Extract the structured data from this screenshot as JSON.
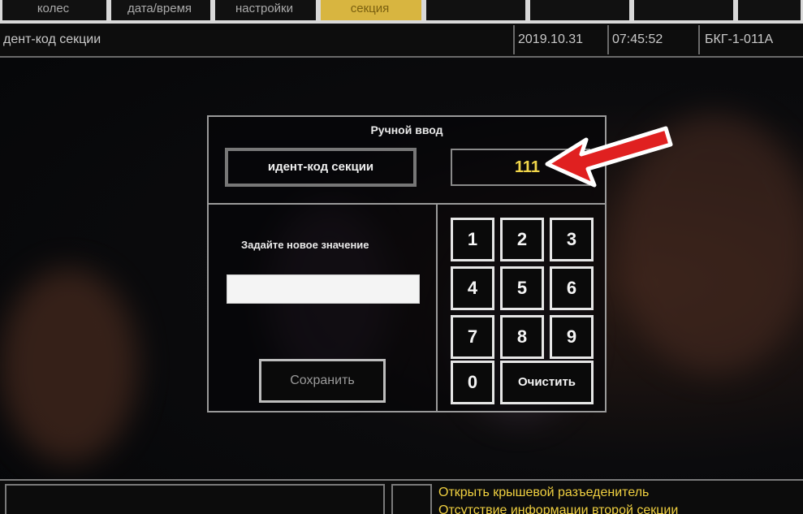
{
  "tabs": [
    {
      "label": "колес"
    },
    {
      "label": "дата/время"
    },
    {
      "label": "настройки"
    },
    {
      "label": "секция"
    }
  ],
  "status_bar": {
    "title": "дент-код секции",
    "date": "2019.10.31",
    "time": "07:45:52",
    "unit": "БКГ-1-011А"
  },
  "dialog": {
    "title": "Ручной ввод",
    "field_label": "идент-код секции",
    "current_value": "111",
    "prompt": "Задайте новое значение",
    "new_value": "",
    "save_label": "Сохранить",
    "keys": [
      "1",
      "2",
      "3",
      "4",
      "5",
      "6",
      "7",
      "8",
      "9",
      "0"
    ],
    "clear_label": "Очистить"
  },
  "messages": [
    "Открыть крышевой разъеденитель",
    "Отсутствие информации второй секции"
  ],
  "colors": {
    "accent_tab": "#d8b540",
    "value_text": "#f1d64a",
    "arrow": "#e02020",
    "message_text": "#f0d040"
  }
}
